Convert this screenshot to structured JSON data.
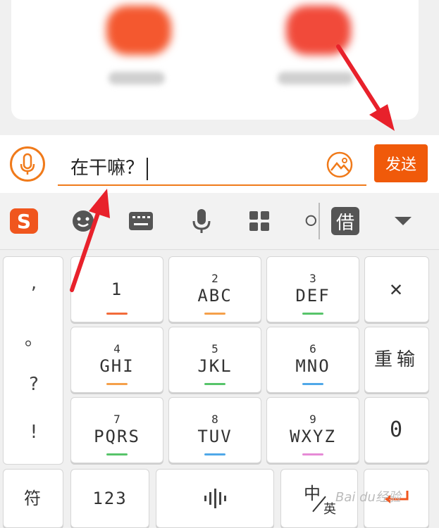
{
  "input": {
    "text": "在干嘛？"
  },
  "send_label": "发送",
  "keys": {
    "k1": {
      "sub": "",
      "main": "1",
      "bar": "#f26b3a"
    },
    "k2": {
      "sub": "2",
      "main": "ABC",
      "bar": "#f5a04a"
    },
    "k3": {
      "sub": "3",
      "main": "DEF",
      "bar": "#57c46a"
    },
    "k4": {
      "sub": "4",
      "main": "GHI",
      "bar": "#f5a04a"
    },
    "k5": {
      "sub": "5",
      "main": "JKL",
      "bar": "#57c46a"
    },
    "k6": {
      "sub": "6",
      "main": "MNO",
      "bar": "#4fa8e8"
    },
    "k7": {
      "sub": "7",
      "main": "PQRS",
      "bar": "#57c46a"
    },
    "k8": {
      "sub": "8",
      "main": "TUV",
      "bar": "#4fa8e8"
    },
    "k9": {
      "sub": "9",
      "main": "WXYZ",
      "bar": "#e68ad6"
    }
  },
  "punctuation": [
    ",",
    "。",
    "?",
    "!"
  ],
  "function_keys": {
    "delete": "✕",
    "reenter": "重输",
    "zero": "0",
    "symbol": "符",
    "numbers": "123",
    "space_icon": "waveform-icon",
    "lang_cn": "中",
    "lang_en": "英"
  },
  "toolbar_icons": [
    "sogou-logo-icon",
    "emoji-icon",
    "keyboard-icon",
    "voice-icon",
    "grid-icon",
    "search-icon",
    "borrow-icon",
    "collapse-icon"
  ],
  "toolbar_borrow_label": "借",
  "watermark": "Bai du经验",
  "colors": {
    "accent": "#f05a0a",
    "arrow": "#e8212b"
  }
}
